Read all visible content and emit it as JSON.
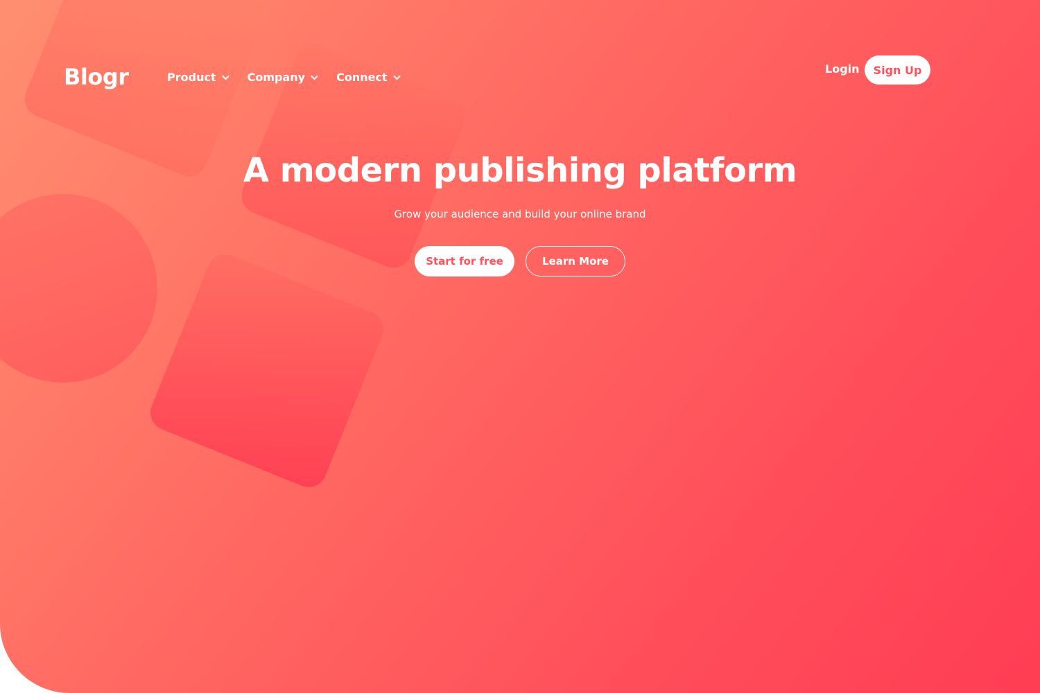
{
  "brand": {
    "logo_text": "Blogr"
  },
  "nav": {
    "items": [
      {
        "label": "Product",
        "icon": "chevron-down-icon"
      },
      {
        "label": "Company",
        "icon": "chevron-down-icon"
      },
      {
        "label": "Connect",
        "icon": "chevron-down-icon"
      }
    ]
  },
  "auth": {
    "login_label": "Login",
    "signup_label": "Sign Up"
  },
  "hero": {
    "title": "A modern publishing platform",
    "subtitle": "Grow your audience and build your online brand",
    "primary_cta": "Start for free",
    "secondary_cta": "Learn More"
  },
  "colors": {
    "gradient_start": "#ff8f70",
    "gradient_end": "#ff3d54",
    "accent_text": "#ff525d",
    "white": "#ffffff"
  }
}
